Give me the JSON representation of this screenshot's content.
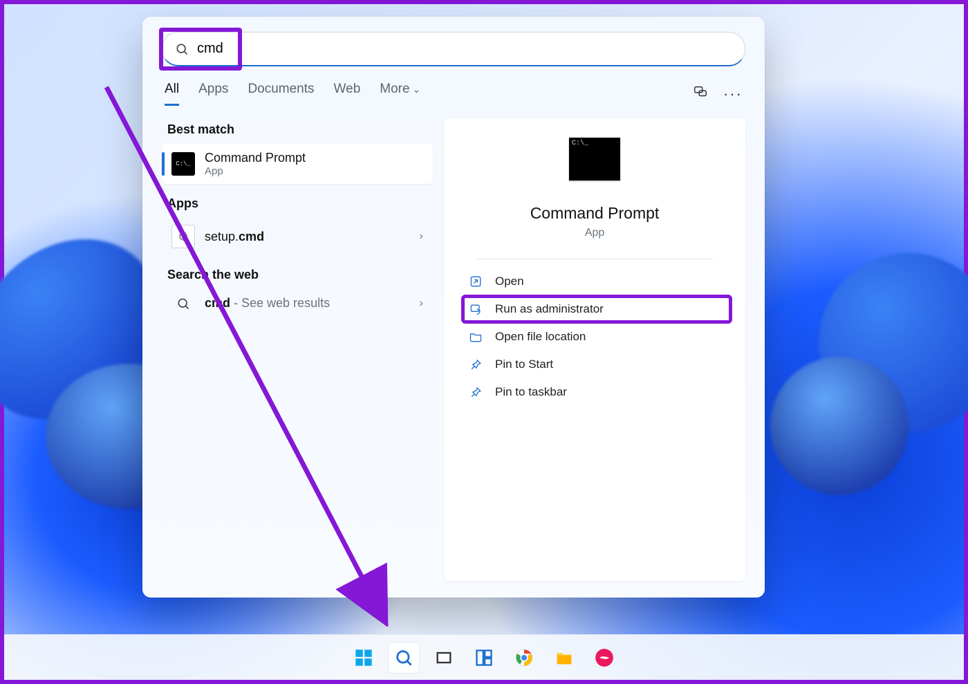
{
  "search": {
    "query": "cmd"
  },
  "tabs": {
    "all": "All",
    "apps": "Apps",
    "documents": "Documents",
    "web": "Web",
    "more": "More"
  },
  "left": {
    "best_match_header": "Best match",
    "best_match": {
      "title": "Command Prompt",
      "subtitle": "App"
    },
    "apps_header": "Apps",
    "apps_item_prefix": "setup.",
    "apps_item_bold": "cmd",
    "search_web_header": "Search the web",
    "web_item_bold": "cmd",
    "web_item_suffix": " - See web results"
  },
  "preview": {
    "title": "Command Prompt",
    "subtitle": "App",
    "actions": {
      "open": "Open",
      "run_admin": "Run as administrator",
      "open_loc": "Open file location",
      "pin_start": "Pin to Start",
      "pin_taskbar": "Pin to taskbar"
    }
  }
}
